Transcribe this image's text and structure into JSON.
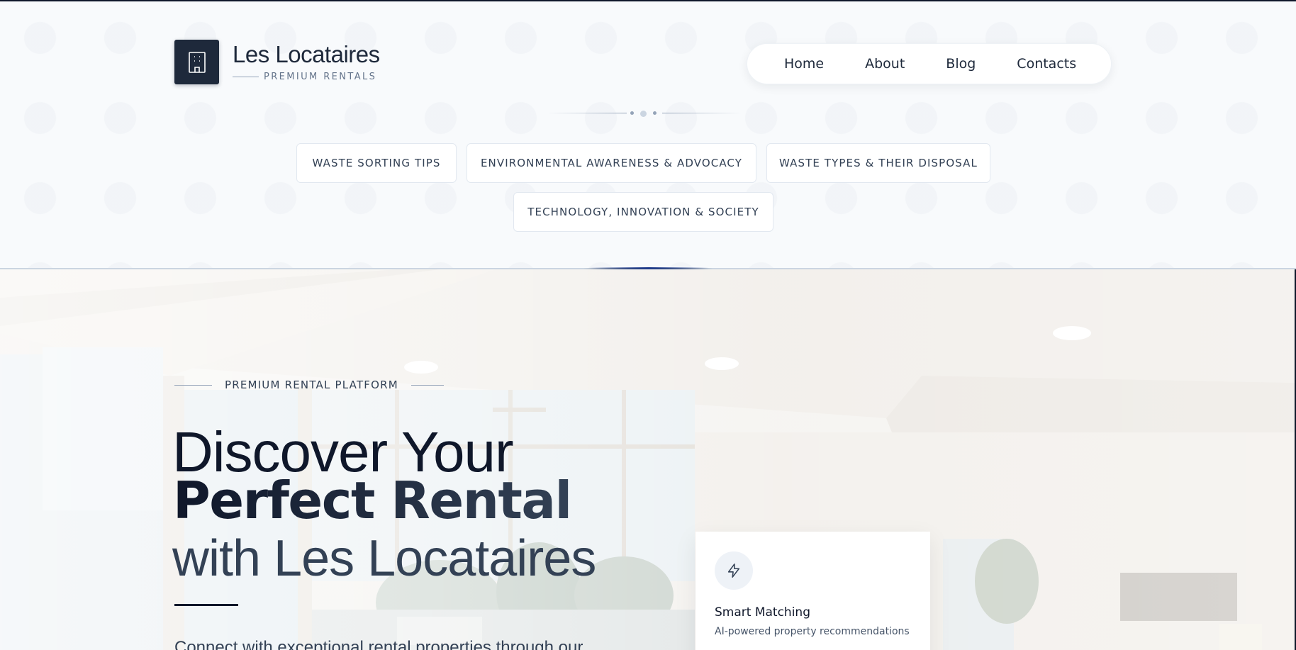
{
  "brand": {
    "name": "Les Locataires",
    "tagline": "PREMIUM RENTALS",
    "icon": "building-icon"
  },
  "nav": {
    "items": [
      {
        "label": "Home"
      },
      {
        "label": "About"
      },
      {
        "label": "Blog"
      },
      {
        "label": "Contacts"
      }
    ]
  },
  "categories": [
    {
      "label": "WASTE SORTING TIPS"
    },
    {
      "label": "ENVIRONMENTAL AWARENESS & ADVOCACY"
    },
    {
      "label": "WASTE TYPES & THEIR DISPOSAL"
    },
    {
      "label": "TECHNOLOGY, INNOVATION & SOCIETY"
    }
  ],
  "hero": {
    "eyebrow": "PREMIUM RENTAL PLATFORM",
    "title_line1": "Discover Your",
    "title_line2": "Perfect Rental",
    "title_line3": "with Les Locataires",
    "lead": "Connect with exceptional rental properties through our"
  },
  "feature_card": {
    "icon": "lightning-icon",
    "title": "Smart Matching",
    "description": "AI-powered property recommendations"
  },
  "colors": {
    "primary": "#1e293b",
    "accent": "#0f172a",
    "muted": "#64748b",
    "border": "#e2e8f0"
  }
}
